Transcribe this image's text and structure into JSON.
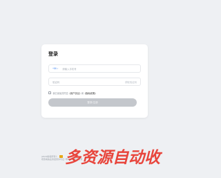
{
  "login": {
    "title": "登录",
    "phone_prefix": "+86",
    "phone_placeholder": "请输入手机号",
    "code_placeholder": "验证码",
    "code_button": "获取验证码",
    "agree_prefix": "我已阅读并同意",
    "user_agreement": "《用户协议》",
    "agree_and": "和",
    "privacy_policy": "《隐私政策》",
    "submit_label": "登录/注册"
  },
  "footer": {
    "line1": "[2023]版权所有©",
    "line2": "增值电信业务经营许可证: 粤B2-",
    "line2_right": "公安备案号"
  },
  "watermark": {
    "text": "多资源自动收"
  },
  "colors": {
    "page_bg": "#eef0f3",
    "card_bg": "#ffffff",
    "accent": "#4a8af4",
    "button_disabled": "#c4c7cc",
    "watermark": "#e8453c"
  }
}
